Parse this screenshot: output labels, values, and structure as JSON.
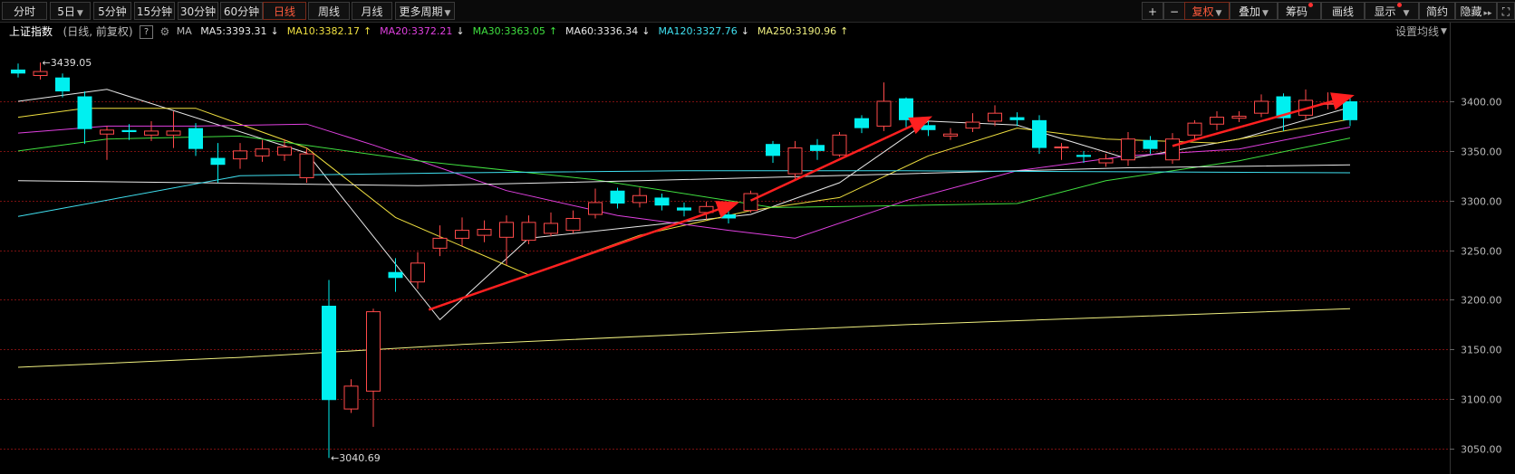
{
  "toolbar": {
    "tabs": [
      {
        "label": "分时",
        "active": false,
        "dropdown": false
      },
      {
        "label": "5日",
        "active": false,
        "dropdown": true
      },
      {
        "label": "5分钟",
        "active": false,
        "dropdown": false
      },
      {
        "label": "15分钟",
        "active": false,
        "dropdown": false
      },
      {
        "label": "30分钟",
        "active": false,
        "dropdown": false
      },
      {
        "label": "60分钟",
        "active": false,
        "dropdown": false
      },
      {
        "label": "日线",
        "active": true,
        "dropdown": false
      },
      {
        "label": "周线",
        "active": false,
        "dropdown": false
      },
      {
        "label": "月线",
        "active": false,
        "dropdown": false
      },
      {
        "label": "更多周期",
        "active": false,
        "dropdown": true
      }
    ],
    "right": {
      "plus": "+",
      "minus": "−",
      "fuquan": "复权",
      "diejia": "叠加",
      "chouma": "筹码",
      "huaxian": "画线",
      "xianshi": "显示",
      "jianyue": "简约",
      "yincang": "隐藏",
      "expand": "⛶"
    }
  },
  "indicator": {
    "name": "上证指数",
    "mode": "(日线, 前复权)",
    "help": "?",
    "ma_label": "MA",
    "settings": "设置均线",
    "ma": [
      {
        "label": "MA5:3393.31",
        "arrow": "↓",
        "color": "#e8e8e8"
      },
      {
        "label": "MA10:3382.17",
        "arrow": "↑",
        "color": "#f0e040"
      },
      {
        "label": "MA20:3372.21",
        "arrow": "↓",
        "color": "#e040e0"
      },
      {
        "label": "MA30:3363.05",
        "arrow": "↑",
        "color": "#40e040"
      },
      {
        "label": "MA60:3336.34",
        "arrow": "↓",
        "color": "#e8e8e8"
      },
      {
        "label": "MA120:3327.76",
        "arrow": "↓",
        "color": "#40e0f0"
      },
      {
        "label": "MA250:3190.96",
        "arrow": "↑",
        "color": "#f0f080"
      }
    ]
  },
  "colors": {
    "up": "#ff4a4a",
    "down": "#00f0f0",
    "grid": "#7a1010",
    "trend": "#ff2020"
  },
  "chart_data": {
    "type": "candlestick",
    "ylim": [
      3030,
      3440
    ],
    "yticks": [
      "3400.00",
      "3350.00",
      "3300.00",
      "3250.00",
      "3200.00",
      "3150.00",
      "3100.00",
      "3050.00"
    ],
    "high_label": "3439.05",
    "low_label": "3040.69",
    "candles": [
      [
        3432,
        3428,
        3438,
        3424
      ],
      [
        3426,
        3430,
        3439.05,
        3422
      ],
      [
        3424,
        3410,
        3428,
        3404
      ],
      [
        3405,
        3372,
        3410,
        3357
      ],
      [
        3367,
        3371,
        3375,
        3341
      ],
      [
        3371,
        3369,
        3377,
        3361
      ],
      [
        3366,
        3370,
        3380,
        3360
      ],
      [
        3366,
        3370,
        3390,
        3353
      ],
      [
        3373,
        3352,
        3378,
        3345
      ],
      [
        3343,
        3336,
        3358,
        3318
      ],
      [
        3342,
        3350,
        3358,
        3332
      ],
      [
        3345,
        3352,
        3361,
        3339
      ],
      [
        3346,
        3354,
        3362,
        3340
      ],
      [
        3323,
        3347,
        3353,
        3318
      ],
      [
        3194,
        3099,
        3220,
        3040.69
      ],
      [
        3090,
        3113,
        3120,
        3086
      ],
      [
        3108,
        3188,
        3191,
        3072
      ],
      [
        3228,
        3222,
        3242,
        3208
      ],
      [
        3218,
        3237,
        3248,
        3211
      ],
      [
        3252,
        3262,
        3275,
        3244
      ],
      [
        3262,
        3270,
        3283,
        3254
      ],
      [
        3265,
        3271,
        3280,
        3258
      ],
      [
        3263,
        3278,
        3285,
        3235
      ],
      [
        3260,
        3278,
        3285,
        3256
      ],
      [
        3267,
        3277,
        3288,
        3264
      ],
      [
        3270,
        3282,
        3290,
        3267
      ],
      [
        3286,
        3298,
        3312,
        3282
      ],
      [
        3310,
        3297,
        3313,
        3292
      ],
      [
        3298,
        3305,
        3313,
        3293
      ],
      [
        3303,
        3295,
        3307,
        3290
      ],
      [
        3293,
        3290,
        3298,
        3284
      ],
      [
        3288,
        3294,
        3299,
        3281
      ],
      [
        3286,
        3282,
        3290,
        3277
      ],
      [
        3290,
        3307,
        3310,
        3288
      ],
      [
        3357,
        3345,
        3360,
        3338
      ],
      [
        3327,
        3353,
        3360,
        3322
      ],
      [
        3356,
        3350,
        3362,
        3341
      ],
      [
        3346,
        3366,
        3369,
        3344
      ],
      [
        3383,
        3373,
        3386,
        3368
      ],
      [
        3375,
        3400,
        3419,
        3370
      ],
      [
        3403,
        3381,
        3404,
        3374
      ],
      [
        3376,
        3371,
        3380,
        3365
      ],
      [
        3365,
        3367,
        3373,
        3361
      ],
      [
        3373,
        3379,
        3388,
        3369
      ],
      [
        3380,
        3388,
        3396,
        3375
      ],
      [
        3384,
        3381,
        3389,
        3375
      ],
      [
        3381,
        3353,
        3386,
        3347
      ],
      [
        3354,
        3354,
        3358,
        3341
      ],
      [
        3346,
        3344,
        3350,
        3338
      ],
      [
        3338,
        3342,
        3347,
        3334
      ],
      [
        3341,
        3362,
        3369,
        3335
      ],
      [
        3361,
        3352,
        3365,
        3347
      ],
      [
        3341,
        3362,
        3368,
        3337
      ],
      [
        3366,
        3378,
        3381,
        3361
      ],
      [
        3377,
        3384,
        3390,
        3371
      ],
      [
        3383,
        3385,
        3390,
        3379
      ],
      [
        3388,
        3400,
        3407,
        3384
      ],
      [
        3405,
        3383,
        3408,
        3370
      ],
      [
        3386,
        3401,
        3412,
        3381
      ],
      [
        3397,
        3398,
        3409,
        3392
      ],
      [
        3400,
        3381,
        3404,
        3375
      ]
    ],
    "ma_series": [
      {
        "name": "MA5",
        "color": "#e8e8e8",
        "points": [
          [
            0,
            3400
          ],
          [
            4,
            3412
          ],
          [
            13,
            3348
          ],
          [
            19,
            3180
          ],
          [
            23,
            3262
          ],
          [
            33,
            3286
          ],
          [
            37,
            3318
          ],
          [
            41,
            3380
          ],
          [
            45,
            3376
          ],
          [
            50,
            3342
          ],
          [
            55,
            3362
          ],
          [
            60,
            3394
          ]
        ]
      },
      {
        "name": "MA10",
        "color": "#f0e040",
        "points": [
          [
            0,
            3384
          ],
          [
            3,
            3393
          ],
          [
            8,
            3393
          ],
          [
            13,
            3353
          ],
          [
            17,
            3283
          ],
          [
            23,
            3225
          ],
          [
            28,
            3265
          ],
          [
            33,
            3290
          ],
          [
            37,
            3303
          ],
          [
            41,
            3345
          ],
          [
            45,
            3373
          ],
          [
            49,
            3362
          ],
          [
            54,
            3358
          ],
          [
            60,
            3382
          ]
        ]
      },
      {
        "name": "MA20",
        "color": "#e040e0",
        "points": [
          [
            0,
            3368
          ],
          [
            4,
            3375
          ],
          [
            8,
            3375
          ],
          [
            13,
            3377
          ],
          [
            16,
            3356
          ],
          [
            22,
            3310
          ],
          [
            27,
            3285
          ],
          [
            32,
            3270
          ],
          [
            35,
            3262
          ],
          [
            40,
            3300
          ],
          [
            45,
            3330
          ],
          [
            50,
            3345
          ],
          [
            55,
            3352
          ],
          [
            60,
            3374
          ]
        ]
      },
      {
        "name": "MA30",
        "color": "#40e040",
        "points": [
          [
            0,
            3350
          ],
          [
            4,
            3362
          ],
          [
            10,
            3365
          ],
          [
            18,
            3340
          ],
          [
            26,
            3321
          ],
          [
            34,
            3293
          ],
          [
            40,
            3295
          ],
          [
            45,
            3297
          ],
          [
            49,
            3320
          ],
          [
            55,
            3340
          ],
          [
            60,
            3363
          ]
        ]
      },
      {
        "name": "MA60",
        "color": "#e8e8e8",
        "points": [
          [
            0,
            3320
          ],
          [
            8,
            3318
          ],
          [
            18,
            3315
          ],
          [
            28,
            3320
          ],
          [
            40,
            3327
          ],
          [
            50,
            3333
          ],
          [
            60,
            3336
          ]
        ]
      },
      {
        "name": "MA120",
        "color": "#40e0f0",
        "points": [
          [
            0,
            3284
          ],
          [
            10,
            3325
          ],
          [
            20,
            3328
          ],
          [
            30,
            3330
          ],
          [
            40,
            3330
          ],
          [
            50,
            3329
          ],
          [
            60,
            3328
          ]
        ]
      },
      {
        "name": "MA250",
        "color": "#f0f080",
        "points": [
          [
            0,
            3132
          ],
          [
            10,
            3142
          ],
          [
            20,
            3155
          ],
          [
            30,
            3165
          ],
          [
            40,
            3175
          ],
          [
            50,
            3183
          ],
          [
            60,
            3191
          ]
        ]
      }
    ],
    "trend_lines": [
      [
        [
          18.5,
          3190
        ],
        [
          32.3,
          3297
        ]
      ],
      [
        [
          33,
          3300
        ],
        [
          41,
          3383
        ]
      ],
      [
        [
          52,
          3355
        ],
        [
          60,
          3405
        ]
      ]
    ]
  }
}
